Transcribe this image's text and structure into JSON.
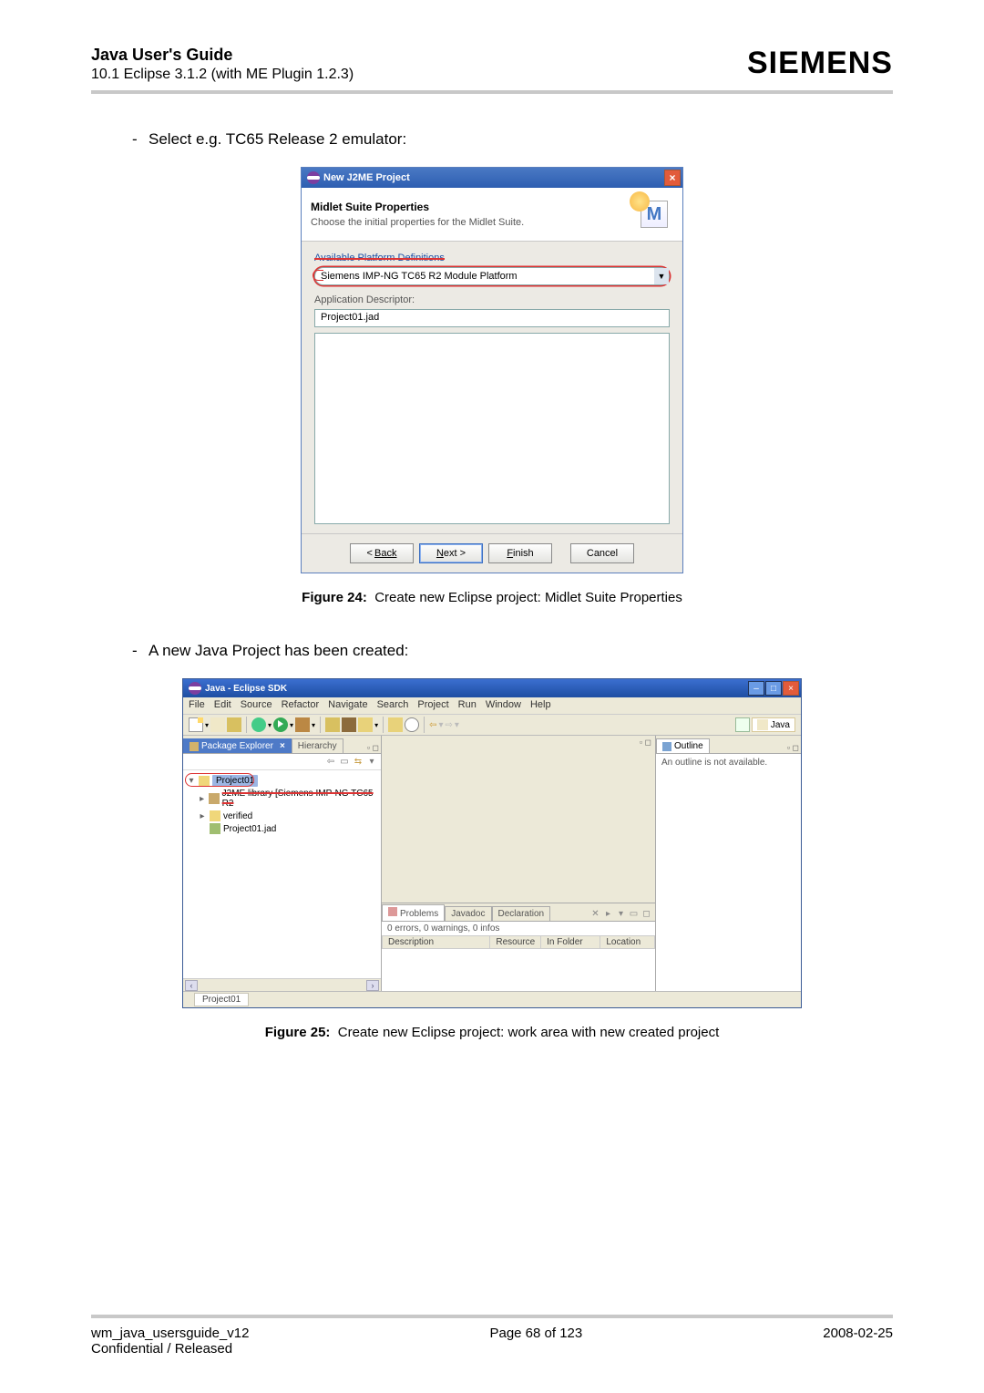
{
  "header": {
    "title": "Java User's Guide",
    "subtitle": "10.1 Eclipse 3.1.2 (with ME Plugin 1.2.3)",
    "brand": "SIEMENS"
  },
  "text": {
    "line1": "Select e.g. TC65 Release 2 emulator:",
    "line2": "A new Java Project has been created:"
  },
  "fig24": {
    "label": "Figure 24:",
    "caption": "Create new Eclipse project: Midlet Suite Properties"
  },
  "fig25": {
    "label": "Figure 25:",
    "caption": "Create new Eclipse project: work area with new created project"
  },
  "dialog": {
    "title": "New J2ME Project",
    "banner_title": "Midlet Suite Properties",
    "banner_sub": "Choose the initial properties for the Midlet Suite.",
    "platform_label": "Available Platform Definitions",
    "platform_value": "Siemens IMP-NG TC65 R2 Module Platform",
    "descriptor_label": "Application Descriptor:",
    "descriptor_value": "Project01.jad",
    "btn_back": "Back",
    "btn_next": "Next >",
    "btn_finish": "Finish",
    "btn_cancel": "Cancel"
  },
  "ide": {
    "title": "Java - Eclipse SDK",
    "menus": [
      "File",
      "Edit",
      "Source",
      "Refactor",
      "Navigate",
      "Search",
      "Project",
      "Run",
      "Window",
      "Help"
    ],
    "perspective": "Java",
    "pkg_tab": "Package Explorer",
    "hier_tab": "Hierarchy",
    "tree": {
      "root": "Project01",
      "lib": "J2ME library [Siemens IMP-NG TC65 R2",
      "verified": "verified",
      "jad": "Project01.jad"
    },
    "outline_tab": "Outline",
    "outline_msg": "An outline is not available.",
    "problems_tab": "Problems",
    "javadoc_tab": "Javadoc",
    "decl_tab": "Declaration",
    "problems_summary": "0 errors, 0 warnings, 0 infos",
    "cols": {
      "desc": "Description",
      "res": "Resource",
      "fold": "In Folder",
      "loc": "Location"
    },
    "status": "Project01"
  },
  "footer": {
    "left1": "wm_java_usersguide_v12",
    "left2": "Confidential / Released",
    "center": "Page 68 of 123",
    "right": "2008-02-25"
  }
}
